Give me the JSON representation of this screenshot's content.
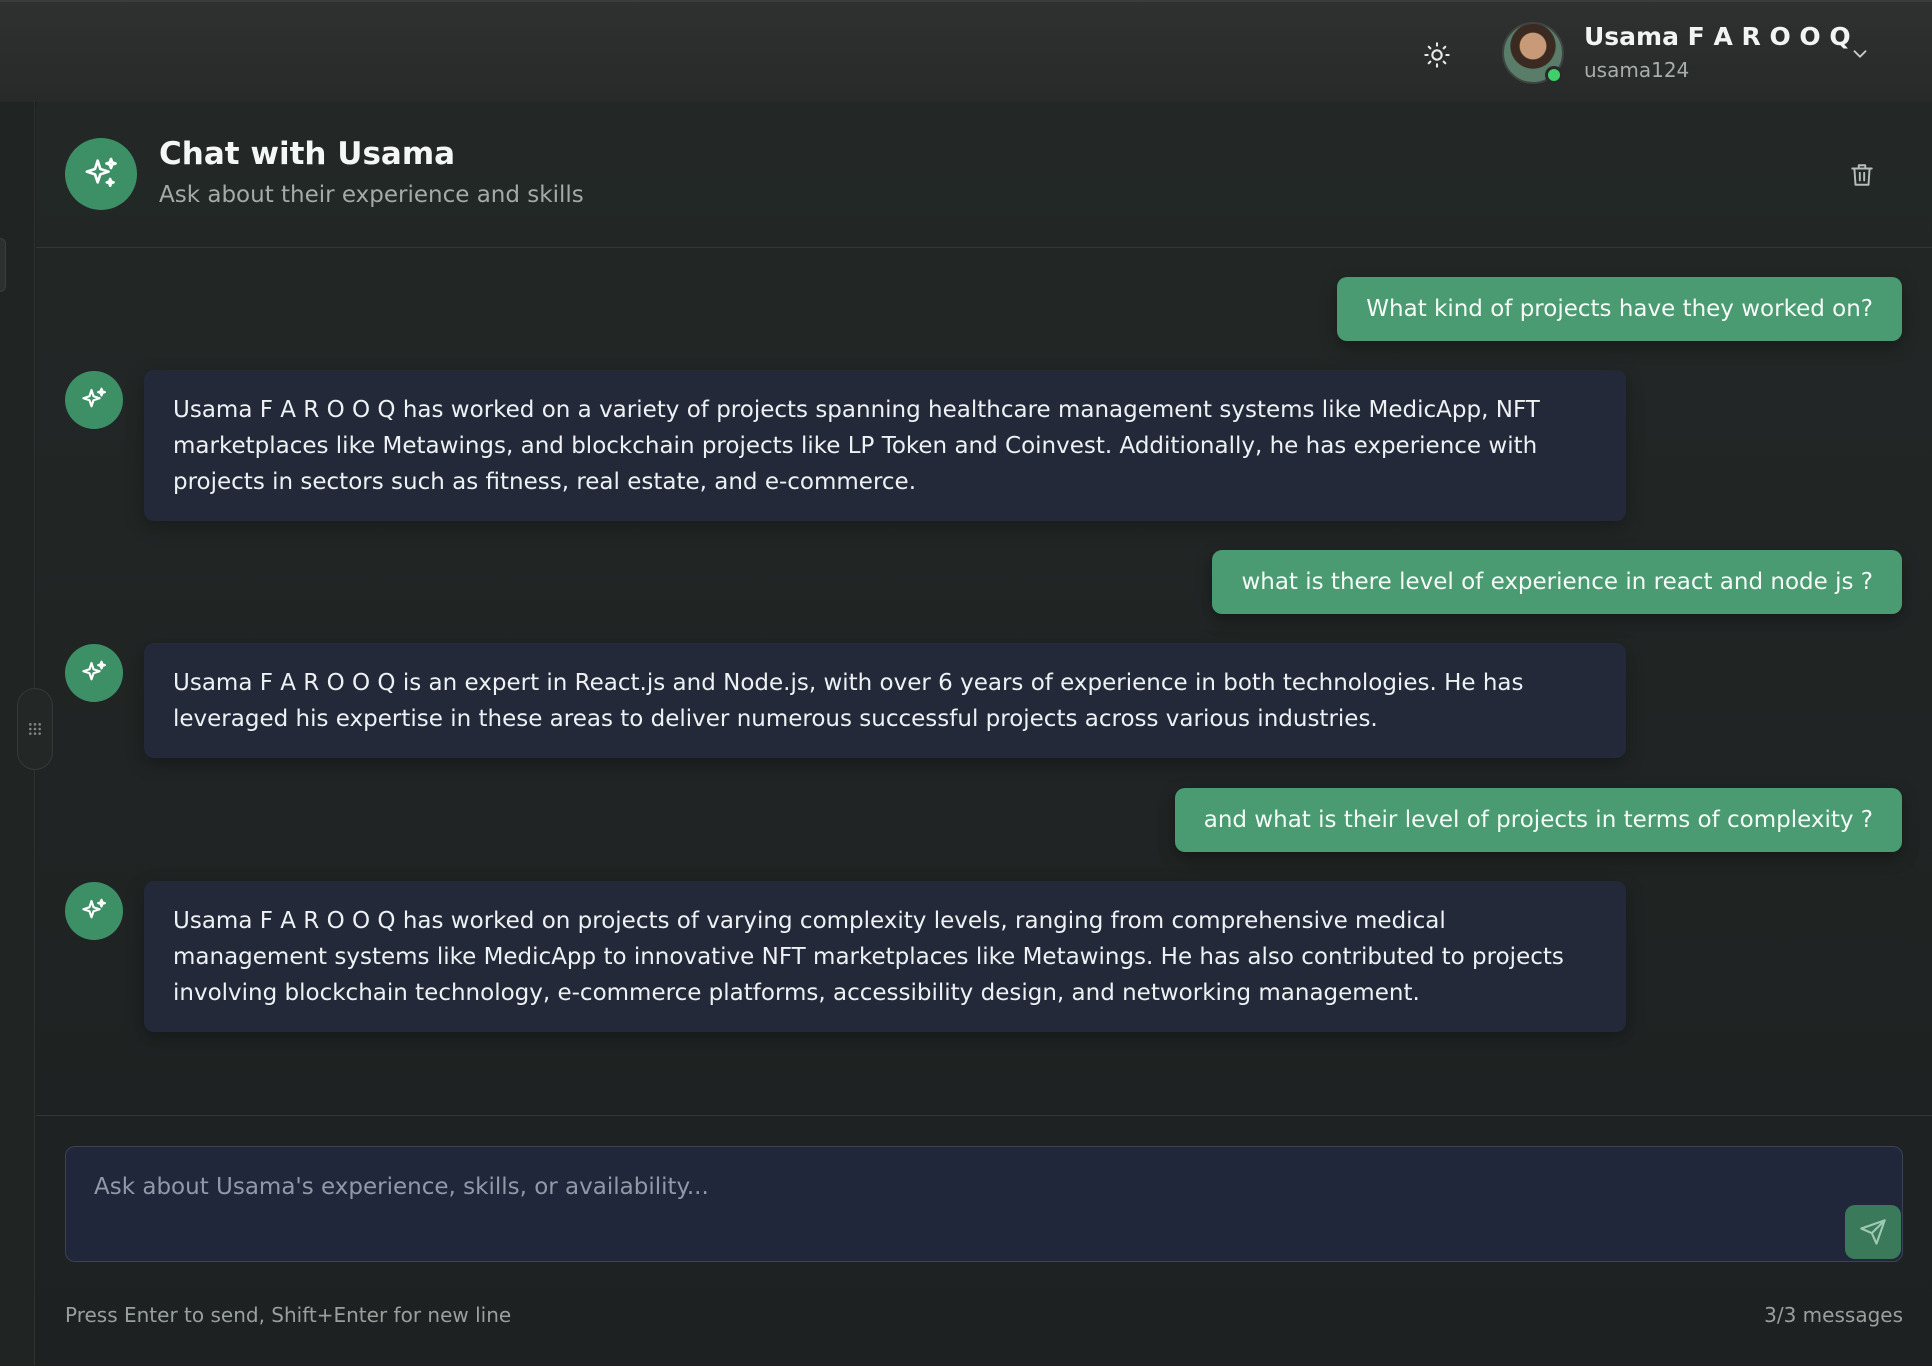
{
  "user": {
    "name": "Usama F A R O O Q",
    "handle": "usama124"
  },
  "chat": {
    "title": "Chat with Usama",
    "subtitle": "Ask about their experience and skills"
  },
  "messages": [
    {
      "role": "user",
      "text": "What kind of projects have they worked on?"
    },
    {
      "role": "assistant",
      "text": "Usama F A R O O Q has worked on a variety of projects spanning healthcare management systems like MedicApp, NFT marketplaces like Metawings, and blockchain projects like LP Token and Coinvest. Additionally, he has experience with projects in sectors such as fitness, real estate, and e-commerce."
    },
    {
      "role": "user",
      "text": "what is there level of experience in react and node js ?"
    },
    {
      "role": "assistant",
      "text": "Usama F A R O O Q is an expert in React.js and Node.js, with over 6 years of experience in both technologies. He has leveraged his expertise in these areas to deliver numerous successful projects across various industries."
    },
    {
      "role": "user",
      "text": "and what is their level of projects in terms of complexity ?"
    },
    {
      "role": "assistant",
      "text": "Usama F A R O O Q has worked on projects of varying complexity levels, ranging from comprehensive medical management systems like MedicApp to innovative NFT marketplaces like Metawings. He has also contributed to projects involving blockchain technology, e-commerce platforms, accessibility design, and networking management."
    }
  ],
  "composer": {
    "placeholder": "Ask about Usama's experience, skills, or availability...",
    "value": "",
    "hint": "Press Enter to send, Shift+Enter for new line",
    "count": "3/3 messages"
  },
  "colors": {
    "accent": "#3d8f66",
    "user_bubble": "#4a9a72",
    "ai_bubble": "#232938",
    "online": "#3fd06a"
  },
  "icons": {
    "theme": "sun-icon",
    "dropdown": "chevron-down-icon",
    "assistant": "sparkles-icon",
    "delete": "trash-icon",
    "send": "send-icon",
    "drag": "grip-dots-icon"
  }
}
